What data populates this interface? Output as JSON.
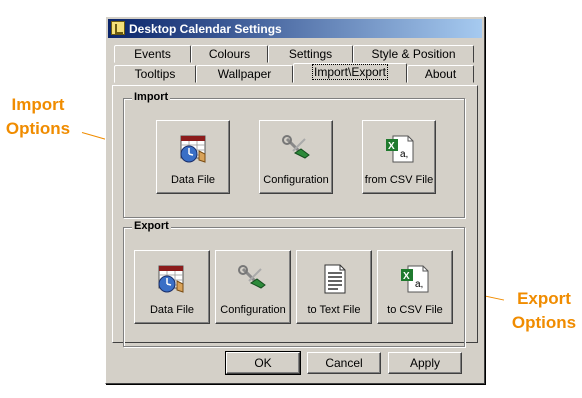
{
  "window": {
    "title": "Desktop Calendar Settings",
    "tabs_row1": [
      "Events",
      "Colours",
      "Settings",
      "Style & Position"
    ],
    "tabs_row2": [
      "Tooltips",
      "Wallpaper",
      "Import\\Export",
      "About"
    ],
    "active_tab": "Import\\Export"
  },
  "import": {
    "label": "Import",
    "buttons": [
      "Data File",
      "Configuration",
      "from CSV File"
    ]
  },
  "export": {
    "label": "Export",
    "buttons": [
      "Data File",
      "Configuration",
      "to Text File",
      "to CSV File"
    ]
  },
  "footer": {
    "ok": "OK",
    "cancel": "Cancel",
    "apply": "Apply"
  },
  "annotations": {
    "import_line1": "Import",
    "import_line2": "Options",
    "export_line1": "Export",
    "export_line2": "Options",
    "color": "#f08c00"
  },
  "icons": {
    "data_file": "calendar-clock-icon",
    "configuration": "wrench-screwdriver-icon",
    "csv": "excel-csv-icon",
    "text": "text-document-icon"
  }
}
